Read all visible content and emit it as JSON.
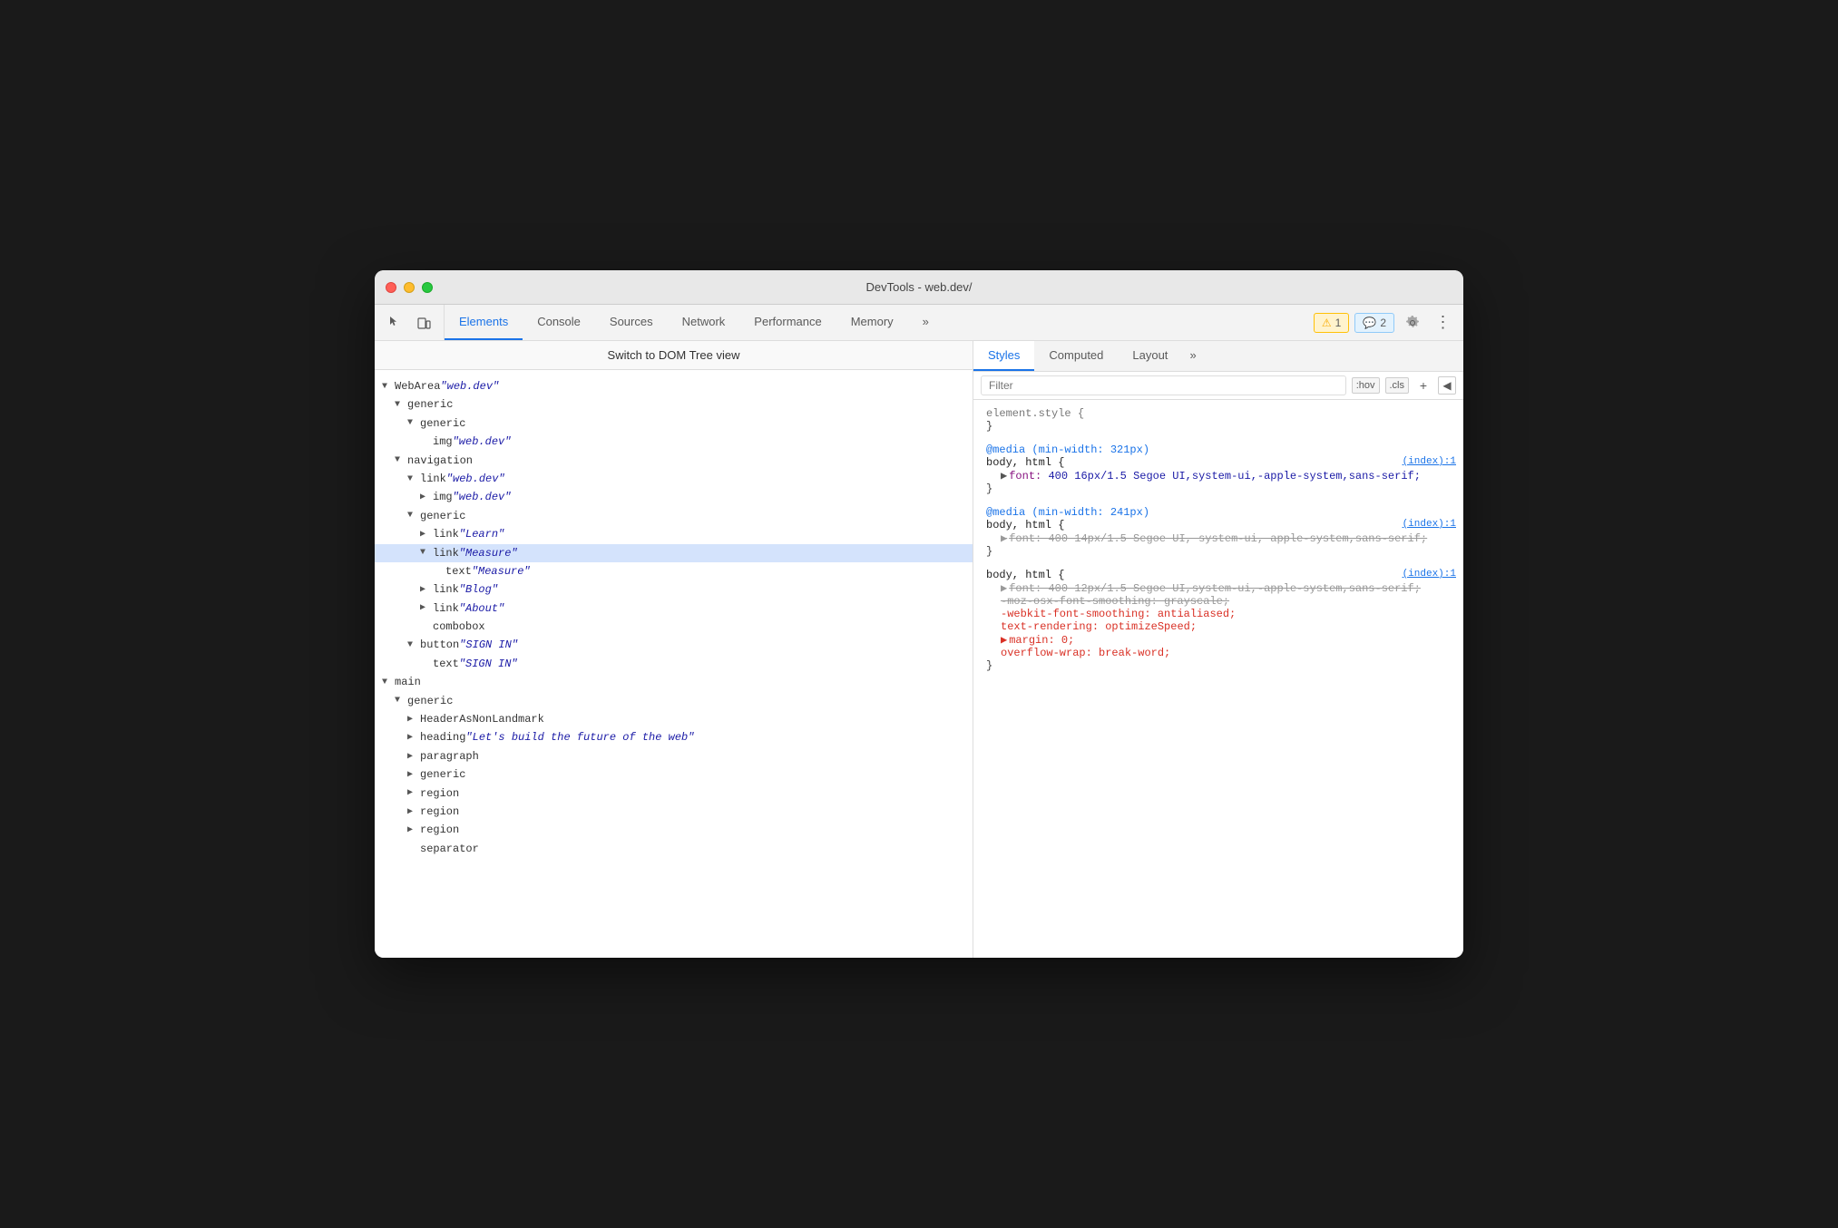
{
  "window": {
    "title": "DevTools - web.dev/"
  },
  "toolbar": {
    "inspector_icon": "⬚",
    "device_icon": "☐",
    "tabs": [
      {
        "label": "Elements",
        "active": true
      },
      {
        "label": "Console",
        "active": false
      },
      {
        "label": "Sources",
        "active": false
      },
      {
        "label": "Network",
        "active": false
      },
      {
        "label": "Performance",
        "active": false
      },
      {
        "label": "Memory",
        "active": false
      },
      {
        "label": "»",
        "active": false
      }
    ],
    "warning_badge": "⚠ 1",
    "info_badge": "💬 2",
    "settings_icon": "⚙",
    "more_icon": "⋮"
  },
  "dom_panel": {
    "switch_label": "Switch to DOM Tree view",
    "tree": [
      {
        "indent": 0,
        "arrow": "expanded",
        "content": "WebArea",
        "string": "\"web.dev\""
      },
      {
        "indent": 1,
        "arrow": "expanded",
        "content": "generic",
        "string": ""
      },
      {
        "indent": 2,
        "arrow": "expanded",
        "content": "generic",
        "string": ""
      },
      {
        "indent": 3,
        "arrow": "leaf",
        "content": "img",
        "string": "\"web.dev\""
      },
      {
        "indent": 1,
        "arrow": "expanded",
        "content": "navigation",
        "string": ""
      },
      {
        "indent": 2,
        "arrow": "expanded",
        "content": "link",
        "string": "\"web.dev\""
      },
      {
        "indent": 3,
        "arrow": "collapsed",
        "content": "img",
        "string": "\"web.dev\""
      },
      {
        "indent": 2,
        "arrow": "expanded",
        "content": "generic",
        "string": ""
      },
      {
        "indent": 3,
        "arrow": "collapsed",
        "content": "link",
        "string": "\"Learn\""
      },
      {
        "indent": 3,
        "arrow": "expanded",
        "content": "link",
        "string": "\"Measure\"",
        "selected": true
      },
      {
        "indent": 4,
        "arrow": "leaf",
        "content": "text",
        "string": "\"Measure\""
      },
      {
        "indent": 3,
        "arrow": "collapsed",
        "content": "link",
        "string": "\"Blog\""
      },
      {
        "indent": 3,
        "arrow": "collapsed",
        "content": "link",
        "string": "\"About\""
      },
      {
        "indent": 3,
        "arrow": "leaf",
        "content": "combobox",
        "string": ""
      },
      {
        "indent": 2,
        "arrow": "expanded",
        "content": "button",
        "string": "\"SIGN IN\""
      },
      {
        "indent": 3,
        "arrow": "leaf",
        "content": "text",
        "string": "\"SIGN IN\""
      },
      {
        "indent": 0,
        "arrow": "expanded",
        "content": "main",
        "string": ""
      },
      {
        "indent": 1,
        "arrow": "expanded",
        "content": "generic",
        "string": ""
      },
      {
        "indent": 2,
        "arrow": "collapsed",
        "content": "HeaderAsNonLandmark",
        "string": ""
      },
      {
        "indent": 2,
        "arrow": "collapsed",
        "content": "heading",
        "string": "\"Let's build the future of the web\""
      },
      {
        "indent": 2,
        "arrow": "collapsed",
        "content": "paragraph",
        "string": ""
      },
      {
        "indent": 2,
        "arrow": "collapsed",
        "content": "generic",
        "string": ""
      },
      {
        "indent": 2,
        "arrow": "collapsed",
        "content": "region",
        "string": ""
      },
      {
        "indent": 2,
        "arrow": "collapsed",
        "content": "region",
        "string": ""
      },
      {
        "indent": 2,
        "arrow": "collapsed",
        "content": "region",
        "string": ""
      },
      {
        "indent": 2,
        "arrow": "leaf",
        "content": "separator",
        "string": ""
      }
    ]
  },
  "styles_panel": {
    "tabs": [
      {
        "label": "Styles",
        "active": true
      },
      {
        "label": "Computed",
        "active": false
      },
      {
        "label": "Layout",
        "active": false
      },
      {
        "label": "»",
        "active": false
      }
    ],
    "filter_placeholder": "Filter",
    "pseudo_label": ":hov",
    "cls_label": ".cls",
    "rules": [
      {
        "selector": "element.style {",
        "close": "}",
        "source": "",
        "properties": []
      },
      {
        "media": "@media (min-width: 321px)",
        "selector": "body, html {",
        "close": "}",
        "source": "(index):1",
        "properties": [
          {
            "name": "font:",
            "value": "▶ 400 16px/1.5 Segoe UI,system-ui,-apple-system,sans-serif;",
            "struck": false,
            "invalid": false,
            "triangle": true
          }
        ]
      },
      {
        "media": "@media (min-width: 241px)",
        "selector": "body, html {",
        "close": "}",
        "source": "(index):1",
        "properties": [
          {
            "name": "font:",
            "value": "▶ 400 14px/1.5 Segoe UI, system-ui, apple-system,sans-serif;",
            "struck": true,
            "invalid": false,
            "triangle": true
          }
        ]
      },
      {
        "media": "",
        "selector": "body, html {",
        "close": "}",
        "source": "(index):1",
        "properties": [
          {
            "name": "font:",
            "value": "▶ 400 12px/1.5 Segoe UI,system-ui,-apple-system,sans-serif;",
            "struck": true,
            "invalid": false,
            "triangle": true
          },
          {
            "name": "-moz-osx-font-smoothing:",
            "value": "grayscale;",
            "struck": true,
            "invalid": false
          },
          {
            "name": "-webkit-font-smoothing:",
            "value": "antialiased;",
            "struck": false,
            "invalid": true
          },
          {
            "name": "text-rendering:",
            "value": "optimizeSpeed;",
            "struck": false,
            "invalid": true
          },
          {
            "name": "margin:",
            "value": "▶ 0;",
            "struck": false,
            "invalid": true,
            "triangle": true
          },
          {
            "name": "overflow-wrap:",
            "value": "break-word;",
            "struck": false,
            "invalid": true
          }
        ]
      }
    ]
  }
}
